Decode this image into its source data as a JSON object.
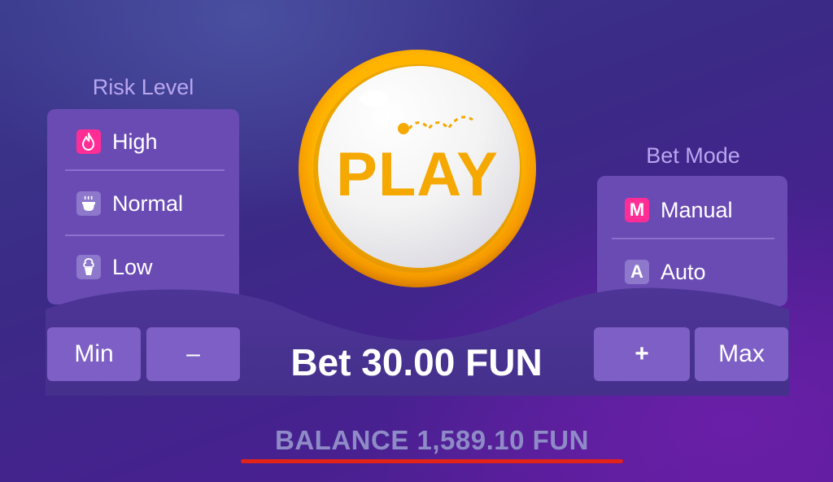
{
  "risk_level": {
    "title": "Risk Level",
    "options": [
      {
        "label": "High",
        "icon": "flame-icon",
        "selected": true
      },
      {
        "label": "Normal",
        "icon": "cup-icon",
        "selected": false
      },
      {
        "label": "Low",
        "icon": "ice-cream-icon",
        "selected": false
      }
    ]
  },
  "bet_mode": {
    "title": "Bet Mode",
    "options": [
      {
        "label": "Manual",
        "icon_letter": "M",
        "selected": true
      },
      {
        "label": "Auto",
        "icon_letter": "A",
        "selected": false
      }
    ]
  },
  "play_button": {
    "label": "PLAY"
  },
  "bet_controls": {
    "min_label": "Min",
    "minus_label": "–",
    "plus_label": "+",
    "max_label": "Max",
    "bet_text": "Bet 30.00 FUN"
  },
  "balance": {
    "text": "BALANCE 1,589.10 FUN"
  },
  "colors": {
    "accent_selected": "#ff2d95",
    "play_text": "#f5a800",
    "play_ring": "#f7a600",
    "panel": "#6a4bb4",
    "button": "#7d5fc6",
    "balance_underline": "#e2231a"
  }
}
